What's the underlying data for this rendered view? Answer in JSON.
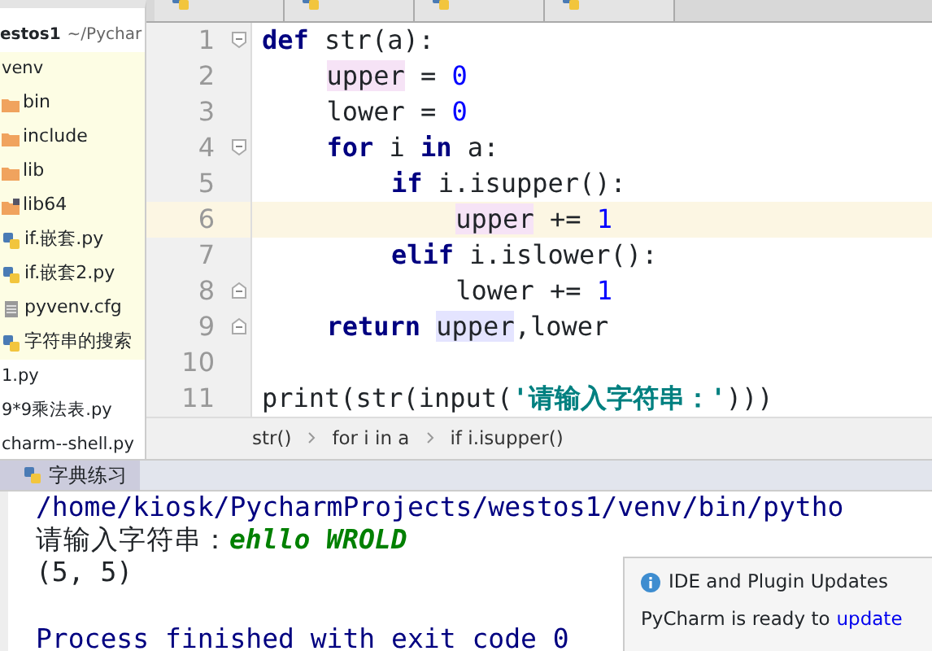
{
  "project": {
    "header": "estos1",
    "header_path": "~/Pychar",
    "items": [
      {
        "label": "venv",
        "kind": "text",
        "in_venv": true
      },
      {
        "label": "bin",
        "kind": "folder",
        "in_venv": true
      },
      {
        "label": "include",
        "kind": "folder",
        "in_venv": true
      },
      {
        "label": "lib",
        "kind": "folder",
        "in_venv": true
      },
      {
        "label": "lib64",
        "kind": "folder-link",
        "in_venv": true
      },
      {
        "label": "if.嵌套.py",
        "kind": "python",
        "in_venv": true
      },
      {
        "label": "if.嵌套2.py",
        "kind": "python",
        "in_venv": true
      },
      {
        "label": "pyvenv.cfg",
        "kind": "config",
        "in_venv": true
      },
      {
        "label": "字符串的搜索",
        "kind": "python",
        "in_venv": true
      },
      {
        "label": "1.py",
        "kind": "text",
        "in_venv": false
      },
      {
        "label": "9*9乘法表.py",
        "kind": "text",
        "in_venv": false
      },
      {
        "label": "charm--shell.py",
        "kind": "text",
        "in_venv": false
      }
    ]
  },
  "editor": {
    "lines": [
      {
        "number": "1",
        "current": false,
        "fold_start": true,
        "fold_end": false,
        "tokens": [
          {
            "kind": "kw",
            "text": "def"
          },
          {
            "kind": "plain",
            "text": " str(a):"
          }
        ],
        "children": [
          {
            "number": "2",
            "current": false,
            "fold_start": false,
            "fold_end": false,
            "tokens": [
              {
                "kind": "hl",
                "text": "upper"
              },
              {
                "kind": "plain",
                "text": " = "
              },
              {
                "kind": "num",
                "text": "0"
              }
            ]
          },
          {
            "number": "3",
            "current": false,
            "fold_start": false,
            "fold_end": false,
            "tokens": [
              {
                "kind": "plain",
                "text": "lower = "
              },
              {
                "kind": "num",
                "text": "0"
              }
            ]
          },
          {
            "number": "4",
            "current": false,
            "fold_start": true,
            "fold_end": false,
            "tokens": [
              {
                "kind": "kw",
                "text": "for"
              },
              {
                "kind": "plain",
                "text": " i "
              },
              {
                "kind": "kw",
                "text": "in"
              },
              {
                "kind": "plain",
                "text": " a:"
              }
            ],
            "children": [
              {
                "number": "5",
                "current": false,
                "fold_start": false,
                "fold_end": false,
                "tokens": [
                  {
                    "kind": "kw",
                    "text": "if"
                  },
                  {
                    "kind": "plain",
                    "text": " i.isupper():"
                  }
                ],
                "children": [
                  {
                    "number": "6",
                    "current": true,
                    "fold_start": false,
                    "fold_end": false,
                    "tokens": [
                      {
                        "kind": "hl",
                        "text": "upper"
                      },
                      {
                        "kind": "plain",
                        "text": " += "
                      },
                      {
                        "kind": "num",
                        "text": "1"
                      }
                    ]
                  }
                ]
              },
              {
                "number": "7",
                "current": false,
                "fold_start": false,
                "fold_end": false,
                "tokens": [
                  {
                    "kind": "kw",
                    "text": "elif"
                  },
                  {
                    "kind": "plain",
                    "text": " i.islower():"
                  }
                ],
                "children": [
                  {
                    "number": "8",
                    "current": false,
                    "fold_start": false,
                    "fold_end": true,
                    "tokens": [
                      {
                        "kind": "plain",
                        "text": "lower += "
                      },
                      {
                        "kind": "num",
                        "text": "1"
                      }
                    ]
                  }
                ]
              }
            ]
          },
          {
            "number": "9",
            "current": false,
            "fold_start": false,
            "fold_end": true,
            "tokens": [
              {
                "kind": "kw",
                "text": "return "
              },
              {
                "kind": "hl2",
                "text": "upper"
              },
              {
                "kind": "plain",
                "text": ",lower"
              }
            ]
          }
        ]
      },
      {
        "number": "10",
        "current": false,
        "fold_start": false,
        "fold_end": false
      },
      {
        "number": "11",
        "current": false,
        "fold_start": false,
        "fold_end": false,
        "tokens": [
          {
            "kind": "plain",
            "text": "print(str(input("
          },
          {
            "kind": "str",
            "text": "'请输入字符串：'"
          },
          {
            "kind": "plain",
            "text": ")))"
          }
        ]
      }
    ],
    "breadcrumbs": [
      "str()",
      "for i in a",
      "if i.isupper()"
    ]
  },
  "run": {
    "tab": "字典练习",
    "lines": [
      {
        "kind": "command",
        "segments": [
          {
            "kind": "command",
            "text": "/home/kiosk/PycharmProjects/westos1/venv/bin/pytho"
          }
        ]
      },
      {
        "kind": "output",
        "segments": [
          {
            "kind": "output",
            "text": "请输入字符串："
          },
          {
            "kind": "input",
            "text": "ehllo WROLD"
          }
        ]
      },
      {
        "kind": "output",
        "segments": [
          {
            "kind": "output",
            "text": "(5, 5)"
          }
        ]
      },
      {
        "kind": "blank"
      },
      {
        "kind": "command",
        "segments": [
          {
            "kind": "command",
            "text": "Process finished with exit code 0"
          }
        ]
      }
    ]
  },
  "notification": {
    "title": "IDE and Plugin Updates",
    "text": "PyCharm is ready to",
    "link": "update"
  }
}
